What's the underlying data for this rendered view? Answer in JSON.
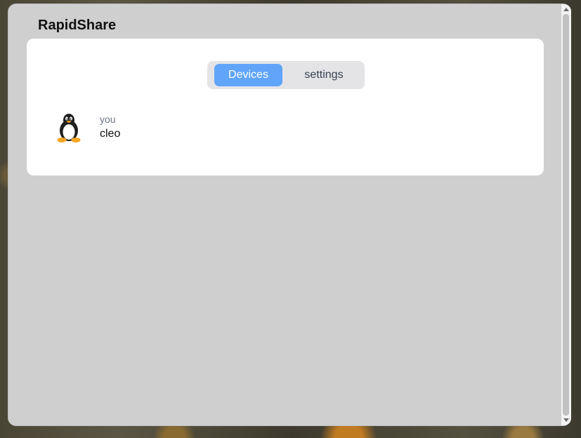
{
  "app": {
    "title": "RapidShare"
  },
  "tabs": [
    {
      "label": "Devices",
      "active": true
    },
    {
      "label": "settings",
      "active": false
    }
  ],
  "devices": [
    {
      "subtitle": "you",
      "name": "cleo",
      "icon": "linux-penguin-icon"
    }
  ],
  "colors": {
    "accent": "#60a5fa",
    "window_bg": "#d0cfd0",
    "card_bg": "#ffffff",
    "tab_bar_bg": "#e4e4e7"
  }
}
